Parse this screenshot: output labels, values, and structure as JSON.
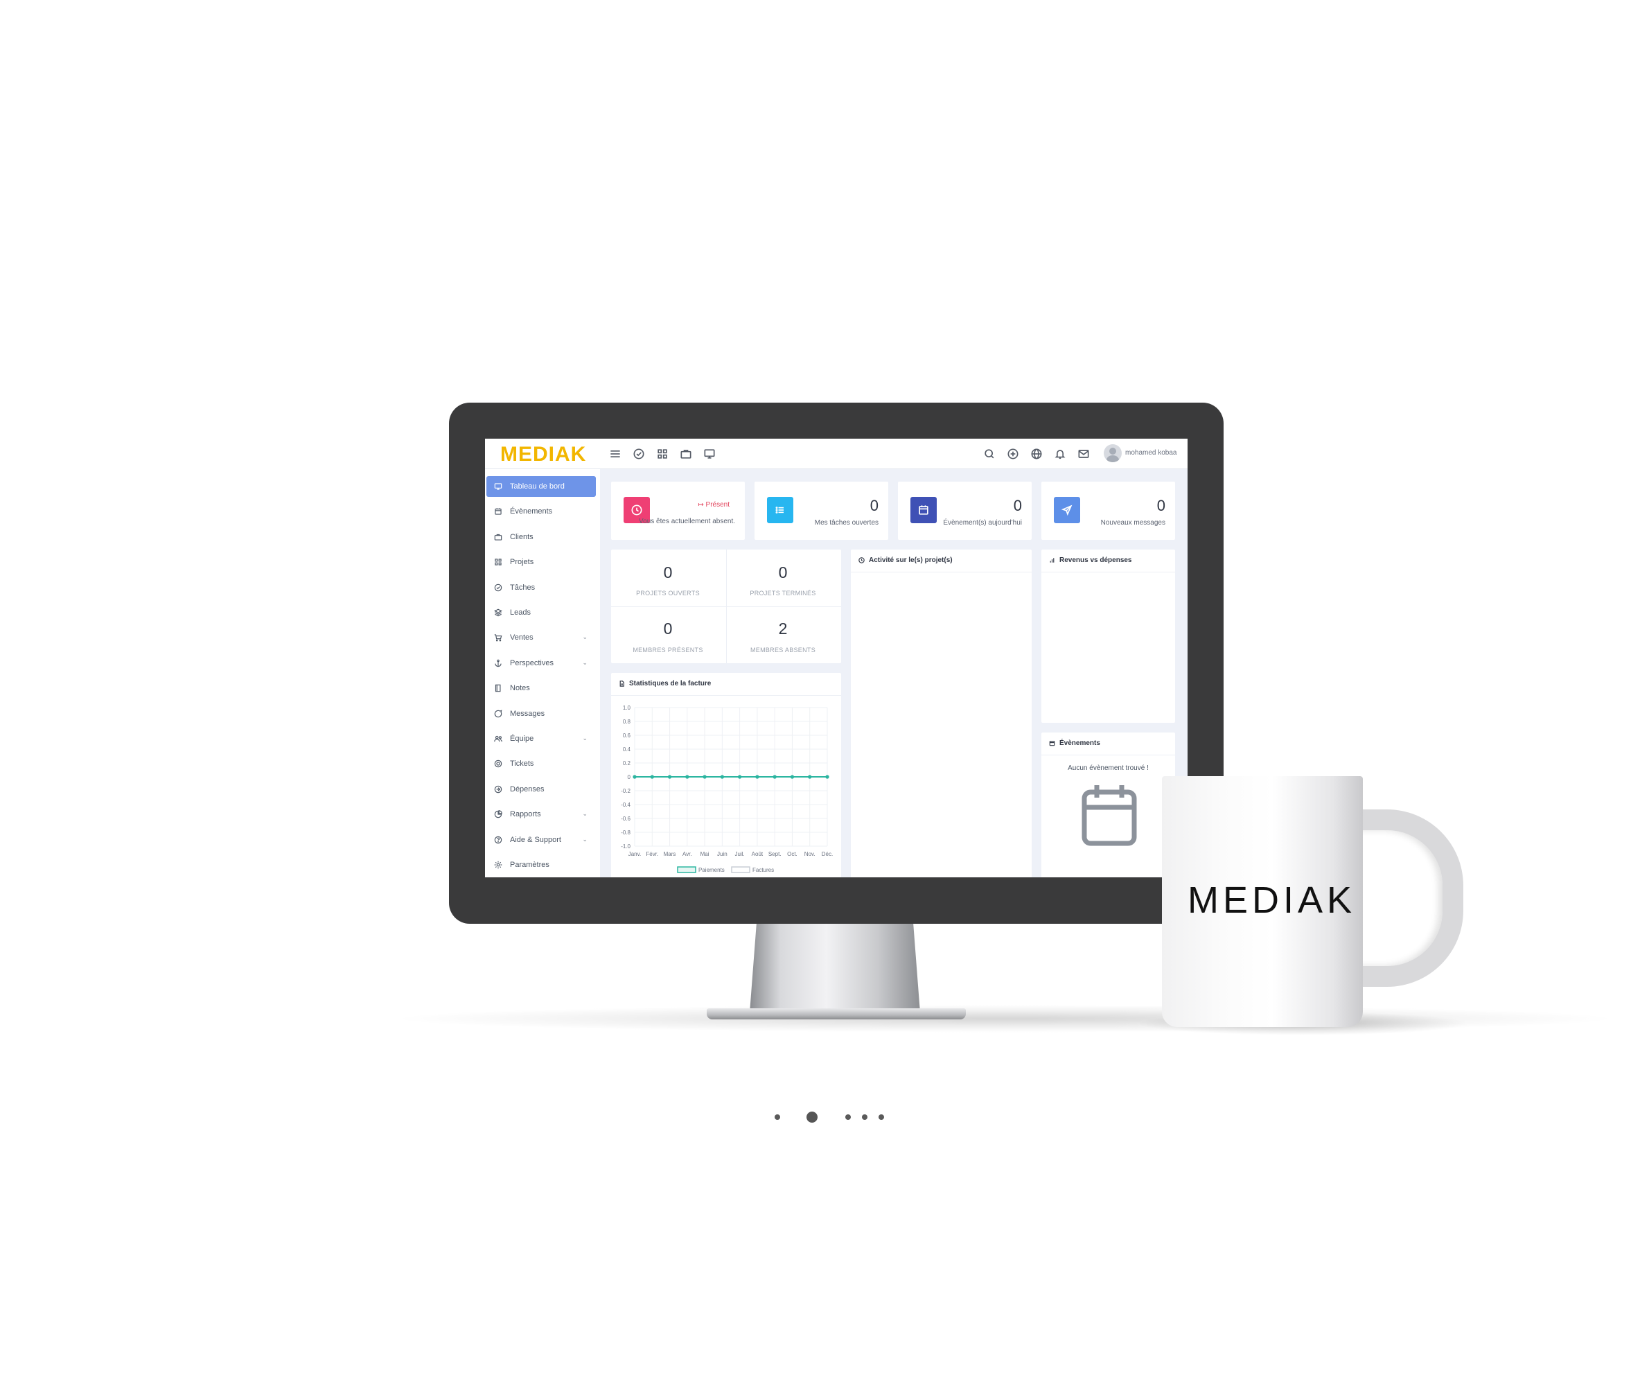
{
  "brand": {
    "logo_text": "MEDIAK",
    "logo_color": "#f2b600",
    "mug_text": "MEDIAK"
  },
  "topbar": {
    "left_icons": [
      "menu-icon",
      "check-circle-icon",
      "grid-icon",
      "briefcase-icon",
      "monitor-icon"
    ],
    "right_icons": [
      "search-icon",
      "plus-circle-icon",
      "globe-icon",
      "bell-icon",
      "mail-icon"
    ],
    "username": "mohamed kobaa"
  },
  "sidebar": {
    "accent_color": "#6e94e8",
    "items": [
      {
        "label": "Tableau de bord",
        "icon": "monitor-icon",
        "active": true
      },
      {
        "label": "Évènements",
        "icon": "calendar-icon"
      },
      {
        "label": "Clients",
        "icon": "briefcase-icon"
      },
      {
        "label": "Projets",
        "icon": "grid-icon"
      },
      {
        "label": "Tâches",
        "icon": "check-circle-icon"
      },
      {
        "label": "Leads",
        "icon": "layers-icon"
      },
      {
        "label": "Ventes",
        "icon": "cart-icon",
        "chevron": "⌄"
      },
      {
        "label": "Perspectives",
        "icon": "anchor-icon",
        "chevron": "⌄"
      },
      {
        "label": "Notes",
        "icon": "book-icon"
      },
      {
        "label": "Messages",
        "icon": "message-icon"
      },
      {
        "label": "Équipe",
        "icon": "users-icon",
        "chevron": "⌄"
      },
      {
        "label": "Tickets",
        "icon": "lifebuoy-icon"
      },
      {
        "label": "Dépenses",
        "icon": "arrow-circle-icon"
      },
      {
        "label": "Rapports",
        "icon": "pie-chart-icon",
        "chevron": "⌄"
      },
      {
        "label": "Aide & Support",
        "icon": "help-circle-icon",
        "chevron": "⌄"
      },
      {
        "label": "Paramètres",
        "icon": "gear-icon"
      }
    ]
  },
  "stats": {
    "attendance": {
      "link": "Présent",
      "text": "Vous êtes actuellement absent.",
      "color": "#ef3f74"
    },
    "tasks": {
      "value": "0",
      "label": "Mes tâches ouvertes",
      "color": "#27b6f0"
    },
    "events": {
      "value": "0",
      "label": "Évènement(s) aujourd'hui",
      "color": "#3f51b5"
    },
    "messages": {
      "value": "0",
      "label": "Nouveaux messages",
      "color": "#5d8fe8"
    }
  },
  "projects": {
    "open": {
      "value": "0",
      "label": "PROJETS OUVERTS"
    },
    "done": {
      "value": "0",
      "label": "PROJETS TERMINÉS"
    },
    "present": {
      "value": "0",
      "label": "MEMBRES PRÉSENTS"
    },
    "absent": {
      "value": "2",
      "label": "MEMBRES ABSENTS"
    }
  },
  "panels": {
    "activity_title": "Activité sur le(s) projet(s)",
    "revenue_title": "Revenus vs dépenses",
    "events_title": "Évènements",
    "events_empty": "Aucun évènement trouvé !",
    "invoice_title": "Statistiques de la facture"
  },
  "chart_data": {
    "type": "line",
    "title": "Statistiques de la facture",
    "categories": [
      "Janv.",
      "Févr.",
      "Mars",
      "Avr.",
      "Mai",
      "Juin",
      "Juil.",
      "Août",
      "Sept.",
      "Oct.",
      "Nov.",
      "Déc."
    ],
    "series": [
      {
        "name": "Paiements",
        "values": [
          0,
          0,
          0,
          0,
          0,
          0,
          0,
          0,
          0,
          0,
          0,
          0
        ],
        "color": "#2bb5a0"
      },
      {
        "name": "Factures",
        "values": [
          0,
          0,
          0,
          0,
          0,
          0,
          0,
          0,
          0,
          0,
          0,
          0
        ],
        "color": "#c9ced6"
      }
    ],
    "yticks": [
      "1.0",
      "0.8",
      "0.6",
      "0.4",
      "0.2",
      "0",
      "-0.2",
      "-0.4",
      "-0.6",
      "-0.8",
      "-1.0"
    ],
    "ylim": [
      -1,
      1
    ],
    "grid": true,
    "legend": "bottom"
  },
  "carousel": {
    "total": 5,
    "active": 1
  }
}
